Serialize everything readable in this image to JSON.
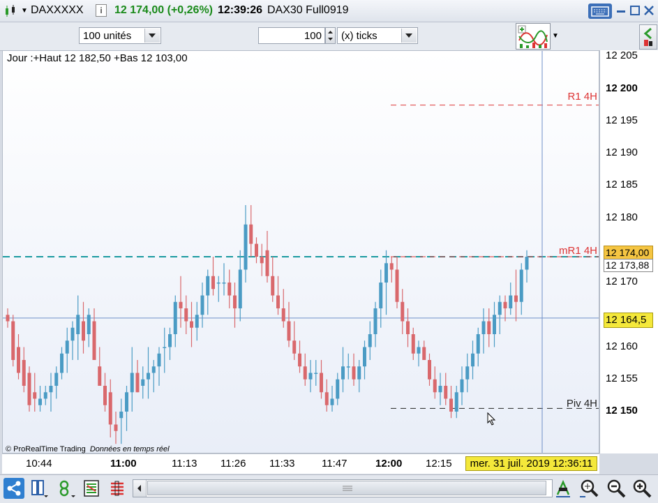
{
  "titlebar": {
    "symbol": "DAXXXXX",
    "info_icon": "info-icon",
    "price_change": "12 174,00 (+0,26%)",
    "time": "12:39:26",
    "instrument": "DAX30 Full0919",
    "price_change_color": "#1a8a1a"
  },
  "toolbar": {
    "units_select": "100 unités",
    "ticks_value": "100",
    "ticks_select": "(x) ticks"
  },
  "chart": {
    "header": "Jour :+Haut 12 182,50 +Bas 12 103,00",
    "footer_credit": "© ProRealTime Trading",
    "footer_note": "Données en temps réel",
    "level_labels": {
      "r1": "R1 4H",
      "mr1": "mR1 4H",
      "piv": "Piv 4H"
    },
    "colors": {
      "up": "#4a9bc4",
      "down": "#d9686c",
      "level_red": "#d33",
      "level_black": "#222",
      "last_price_line": "#1a9aa0",
      "crosshair": "#6f8fc8"
    }
  },
  "yaxis": {
    "ticks": [
      "12 205",
      "12 200",
      "12 195",
      "12 190",
      "12 185",
      "12 180",
      "12 170",
      "12 160",
      "12 155",
      "12 150"
    ],
    "bold_ticks": [
      "12 200",
      "12 150"
    ],
    "last_price": "12 174,00",
    "bid_price": "12 173,88",
    "cursor_price": "12 164,5"
  },
  "xaxis": {
    "ticks": [
      "10:44",
      "11:00",
      "11:13",
      "11:26",
      "11:33",
      "11:47",
      "12:00",
      "12:15"
    ],
    "bold_ticks": [
      "11:00",
      "12:00"
    ],
    "cursor_time": "mer. 31 juil. 2019 12:36:11"
  },
  "chart_data": {
    "type": "candlestick",
    "ylim": [
      12145,
      12205
    ],
    "levels": {
      "R1 4H": 12197.5,
      "mR1 4H": 12174,
      "Piv 4H": 12150.5
    },
    "last_price": 12174.0,
    "cursor_price": 12164.5,
    "ohlc": [
      [
        12165,
        12166,
        12163,
        12164
      ],
      [
        12164,
        12165,
        12157,
        12158
      ],
      [
        12160,
        12162,
        12155,
        12156
      ],
      [
        12158,
        12160,
        12153,
        12154
      ],
      [
        12156,
        12157,
        12150,
        12151
      ],
      [
        12153,
        12156,
        12150,
        12152
      ],
      [
        12151,
        12154,
        12150,
        12152
      ],
      [
        12152,
        12154,
        12151,
        12153
      ],
      [
        12153,
        12156,
        12150,
        12154
      ],
      [
        12154,
        12157,
        12152,
        12156
      ],
      [
        12156,
        12160,
        12155,
        12159
      ],
      [
        12159,
        12163,
        12156,
        12161
      ],
      [
        12161,
        12164,
        12158,
        12163
      ],
      [
        12162,
        12168,
        12158,
        12165
      ],
      [
        12164,
        12167,
        12159,
        12161
      ],
      [
        12162,
        12166,
        12160,
        12165
      ],
      [
        12164,
        12166,
        12158,
        12158
      ],
      [
        12157,
        12160,
        12154,
        12154
      ],
      [
        12154,
        12156,
        12150,
        12151
      ],
      [
        12153,
        12155,
        12146,
        12148
      ],
      [
        12148,
        12150,
        12145,
        12147
      ],
      [
        12149,
        12152,
        12145,
        12150
      ],
      [
        12150,
        12154,
        12147,
        12153
      ],
      [
        12153,
        12160,
        12150,
        12156
      ],
      [
        12156,
        12158,
        12153,
        12153
      ],
      [
        12154,
        12157,
        12152,
        12155
      ],
      [
        12155,
        12160,
        12152,
        12156
      ],
      [
        12156,
        12158,
        12153,
        12157
      ],
      [
        12157,
        12160,
        12154,
        12159
      ],
      [
        12160,
        12163,
        12156,
        12160
      ],
      [
        12160,
        12163,
        12158,
        12162
      ],
      [
        12162,
        12168,
        12160,
        12167
      ],
      [
        12167,
        12171,
        12163,
        12166
      ],
      [
        12166,
        12168,
        12162,
        12164
      ],
      [
        12164,
        12167,
        12160,
        12163
      ],
      [
        12163,
        12167,
        12161,
        12165
      ],
      [
        12165,
        12170,
        12163,
        12168
      ],
      [
        12168,
        12172,
        12165,
        12171
      ],
      [
        12171,
        12174,
        12168,
        12169
      ],
      [
        12170,
        12171,
        12167,
        12170
      ],
      [
        12170,
        12173,
        12168,
        12170
      ],
      [
        12170,
        12172,
        12166,
        12168
      ],
      [
        12168,
        12170,
        12163,
        12166
      ],
      [
        12166,
        12175,
        12164,
        12172
      ],
      [
        12172,
        12182,
        12170,
        12179
      ],
      [
        12179,
        12182,
        12174,
        12176
      ],
      [
        12176,
        12177,
        12173,
        12174
      ],
      [
        12174,
        12176,
        12171,
        12173
      ],
      [
        12175,
        12178,
        12170,
        12171
      ],
      [
        12171,
        12174,
        12167,
        12168
      ],
      [
        12168,
        12171,
        12165,
        12166
      ],
      [
        12166,
        12169,
        12163,
        12164
      ],
      [
        12164,
        12167,
        12160,
        12161
      ],
      [
        12161,
        12164,
        12158,
        12159
      ],
      [
        12159,
        12161,
        12156,
        12157
      ],
      [
        12157,
        12159,
        12154,
        12155
      ],
      [
        12155,
        12158,
        12153,
        12156
      ],
      [
        12156,
        12158,
        12154,
        12156
      ],
      [
        12156,
        12158,
        12152,
        12153
      ],
      [
        12153,
        12155,
        12150,
        12151
      ],
      [
        12151,
        12154,
        12150,
        12152
      ],
      [
        12152,
        12156,
        12151,
        12155
      ],
      [
        12155,
        12160,
        12153,
        12157
      ],
      [
        12157,
        12159,
        12155,
        12157
      ],
      [
        12157,
        12159,
        12154,
        12155
      ],
      [
        12155,
        12158,
        12153,
        12157
      ],
      [
        12157,
        12161,
        12155,
        12160
      ],
      [
        12160,
        12164,
        12158,
        12162
      ],
      [
        12162,
        12167,
        12160,
        12166
      ],
      [
        12166,
        12172,
        12163,
        12170
      ],
      [
        12170,
        12175,
        12165,
        12173
      ],
      [
        12173,
        12174,
        12170,
        12172
      ],
      [
        12172,
        12174,
        12166,
        12167
      ],
      [
        12167,
        12169,
        12162,
        12164
      ],
      [
        12164,
        12166,
        12160,
        12162
      ],
      [
        12162,
        12163,
        12158,
        12159
      ],
      [
        12159,
        12161,
        12157,
        12160
      ],
      [
        12160,
        12161,
        12158,
        12158
      ],
      [
        12158,
        12159,
        12154,
        12155
      ],
      [
        12155,
        12157,
        12152,
        12153
      ],
      [
        12153,
        12156,
        12151,
        12154
      ],
      [
        12154,
        12156,
        12151,
        12152
      ],
      [
        12152,
        12154,
        12149,
        12150
      ],
      [
        12150,
        12154,
        12149,
        12153
      ],
      [
        12153,
        12157,
        12151,
        12155
      ],
      [
        12155,
        12159,
        12153,
        12157
      ],
      [
        12157,
        12161,
        12155,
        12159
      ],
      [
        12159,
        12163,
        12157,
        12162
      ],
      [
        12162,
        12166,
        12159,
        12164
      ],
      [
        12164,
        12166,
        12160,
        12162
      ],
      [
        12162,
        12167,
        12160,
        12165
      ],
      [
        12165,
        12168,
        12162,
        12167
      ],
      [
        12167,
        12168,
        12164,
        12166
      ],
      [
        12166,
        12170,
        12165,
        12168
      ],
      [
        12168,
        12172,
        12164,
        12167
      ],
      [
        12167,
        12173,
        12165,
        12172
      ],
      [
        12172,
        12175,
        12170,
        12174
      ]
    ]
  }
}
